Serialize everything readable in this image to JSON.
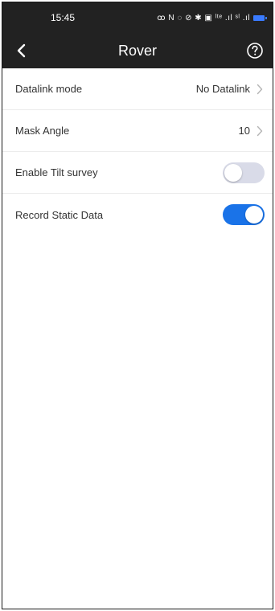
{
  "status_bar": {
    "time": "15:45",
    "icons": "ꝏ N ◌ ⊘ ✱ ▣ ˡᵗᵉ .ıl ˢˡ .ıl",
    "battery_color": "#3a7bff"
  },
  "header": {
    "title": "Rover",
    "back_icon": "chevron-left-icon",
    "help_icon": "help-circle-icon"
  },
  "settings": {
    "datalink_mode": {
      "label": "Datalink mode",
      "value": "No Datalink"
    },
    "mask_angle": {
      "label": "Mask Angle",
      "value": "10"
    },
    "enable_tilt_survey": {
      "label": "Enable Tilt survey",
      "enabled": false
    },
    "record_static_data": {
      "label": "Record Static Data",
      "enabled": true
    }
  },
  "colors": {
    "header_bg": "#222222",
    "toggle_on": "#1a73e8",
    "toggle_off": "#d9dbe8"
  }
}
